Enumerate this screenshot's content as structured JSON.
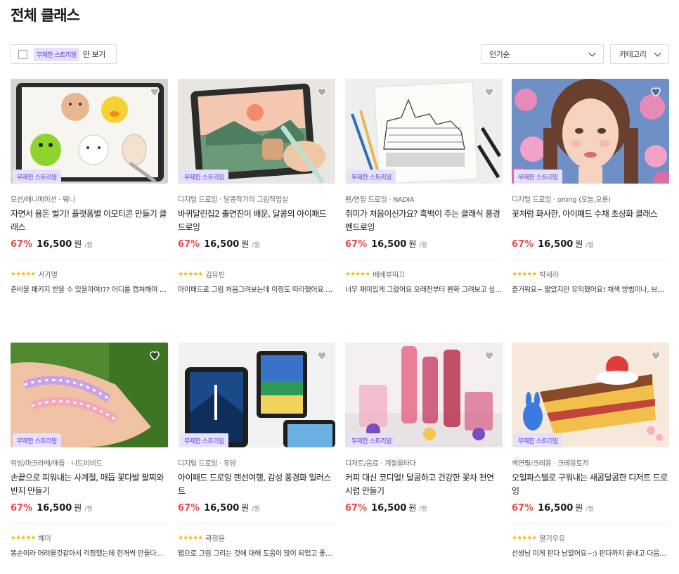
{
  "page_title": "전체 클래스",
  "filter": {
    "badge": "무제한 스트리밍",
    "label": "만 보기"
  },
  "sort": {
    "selected": "인기순"
  },
  "category": {
    "label": "카테고리"
  },
  "badge_text": "무제한 스트리밍",
  "stars": "★★★★★",
  "cards": [
    {
      "category": "모션/애니메이션 · 웨니",
      "title": "자면서 용돈 벌기! 플랫폼별 이모티콘 만들기 클래스",
      "discount": "67%",
      "price": "16,500",
      "currency": "원",
      "per": "/월",
      "reviewer": "서가영",
      "review": "준비물 패키지 받을 수 있을까여!?? 어디를 캡쳐해야 할지 모르겠어요"
    },
    {
      "category": "디지털 드로잉 · 달콩작가의 그림작업실",
      "title": "바퀴달린집2 출연진이 배운, 달콩의 아이패드 드로잉",
      "discount": "67%",
      "price": "16,500",
      "currency": "원",
      "per": "/월",
      "reviewer": "김유빈",
      "review": "아이패드로 그림 처음그려보는데 이정도 따라했어요 감사합니다"
    },
    {
      "category": "펜/연필 드로잉 · NADIA",
      "title": "취미가 처음이신가요? 흑백이 주는 클래식 풍경 펜드로잉",
      "discount": "67%",
      "price": "16,500",
      "currency": "원",
      "per": "/월",
      "reviewer": "베베부띠끄",
      "review": "너무 재미있게 그렸어요 오래전부터 펜화 그려보고 싶었거든요"
    },
    {
      "category": "디지털 드로잉 · orong (오늘,오롱)",
      "title": "꽃처럼 화사한, 아이패드 수채 초상화 클래스",
      "discount": "67%",
      "price": "16,500",
      "currency": "원",
      "per": "/월",
      "reviewer": "박세라",
      "review": "즐거워요~ 짧았지만 유익했어요! 채색 방법이나, 브러쉬 사용법"
    },
    {
      "category": "위빙/마크라메/매듭 · 니드비비드",
      "title": "손끝으로 피워내는 사계절, 매듭 꽃다발 팔찌와 반지 만들기",
      "discount": "67%",
      "price": "16,500",
      "currency": "원",
      "per": "/월",
      "reviewer": "혜미",
      "review": "똥손이라 어려울것같아서 걱정했는데 한개씩 만들다보니 금방"
    },
    {
      "category": "디지털 드로잉 · 유담",
      "title": "아이패드 드로잉 랜선여행, 감성 풍경화 일러스트",
      "discount": "67%",
      "price": "16,500",
      "currency": "원",
      "per": "/월",
      "reviewer": "곽정윤",
      "review": "탭으로 그림 그리는 것에 대해 도움이 많이 되었고 좋았습니다"
    },
    {
      "category": "디저트/음료 · 계절을타다",
      "title": "커피 대신 코디얼! 달콤하고 건강한 꽃차 천연 시럽 만들기",
      "discount": "67%",
      "price": "16,500",
      "currency": "원",
      "per": "/월",
      "reviewer": "",
      "review": ""
    },
    {
      "category": "색연필/크레용 · 크레용토끼",
      "title": "오일파스텔로 구워내는 새콤달콤한 디저트 드로잉",
      "discount": "67%",
      "price": "16,500",
      "currency": "원",
      "per": "/월",
      "reviewer": "딸기우유",
      "review": "선생님 이게 판다 남았어요~:) 판다까지 끝내고 다음에도"
    }
  ]
}
